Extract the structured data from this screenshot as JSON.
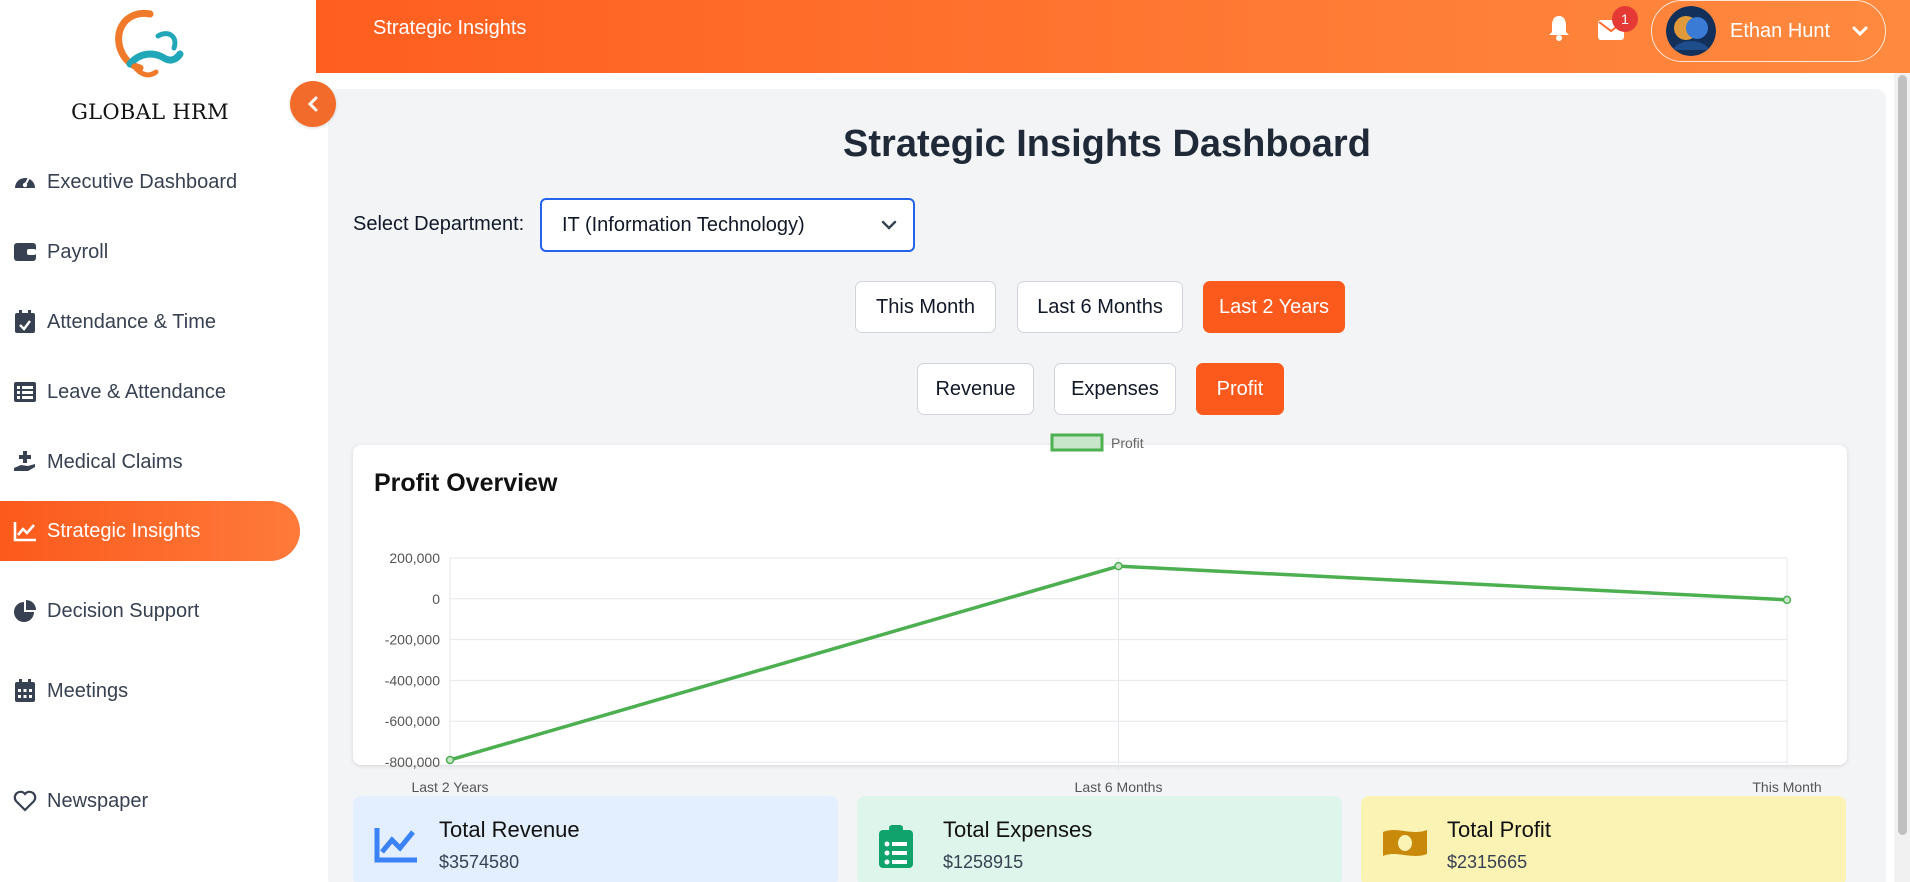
{
  "sidebar": {
    "brand": "GLOBAL HRM",
    "items": [
      {
        "label": "Executive Dashboard",
        "icon": "gauge-icon"
      },
      {
        "label": "Payroll",
        "icon": "wallet-icon"
      },
      {
        "label": "Attendance & Time",
        "icon": "calendar-check-icon"
      },
      {
        "label": "Leave & Attendance",
        "icon": "list-icon"
      },
      {
        "label": "Medical Claims",
        "icon": "hand-holding-medical-icon"
      },
      {
        "label": "Strategic Insights",
        "icon": "chart-line-icon",
        "active": true
      },
      {
        "label": "Decision Support",
        "icon": "pie-chart-icon"
      },
      {
        "label": "Meetings",
        "icon": "calendar-icon"
      },
      {
        "label": "Newspaper",
        "icon": "heart-icon"
      }
    ]
  },
  "topbar": {
    "title": "Strategic Insights",
    "mail_badge": "1",
    "user_name": "Ethan Hunt"
  },
  "main": {
    "page_title": "Strategic Insights Dashboard",
    "department_label": "Select Department:",
    "department_value": "IT (Information Technology)",
    "period_buttons": [
      "This Month",
      "Last 6 Months",
      "Last 2 Years"
    ],
    "active_period": "Last 2 Years",
    "metric_buttons": [
      "Revenue",
      "Expenses",
      "Profit"
    ],
    "active_metric": "Profit",
    "chart_card_title": "Profit Overview"
  },
  "chart_data": {
    "type": "line",
    "categories": [
      "Last 2 Years",
      "Last 6 Months",
      "This Month"
    ],
    "series": [
      {
        "name": "Profit",
        "values": [
          -790000,
          160000,
          -5000
        ],
        "color": "#4caf50"
      }
    ],
    "yticks": [
      200000,
      0,
      -200000,
      -400000,
      -600000,
      -800000
    ],
    "ytick_labels": [
      "200,000",
      "0",
      "-200,000",
      "-400,000",
      "-600,000",
      "-800,000"
    ],
    "ylim": [
      -800000,
      200000
    ],
    "legend": "top-center",
    "grid": true
  },
  "stats": [
    {
      "title": "Total Revenue",
      "value": "$3574580",
      "bg": "#e3efff",
      "icon": "chart-line-icon",
      "icon_color": "#3b82f6"
    },
    {
      "title": "Total Expenses",
      "value": "$1258915",
      "bg": "#ddf5ea",
      "icon": "clipboard-list-icon",
      "icon_color": "#10a36b"
    },
    {
      "title": "Total Profit",
      "value": "$2315665",
      "bg": "#fbf3b4",
      "icon": "money-bill-icon",
      "icon_color": "#c98a0c"
    }
  ],
  "colors": {
    "accent": "#fb5a1c",
    "select_border": "#2563eb",
    "profit_line": "#4caf50"
  }
}
